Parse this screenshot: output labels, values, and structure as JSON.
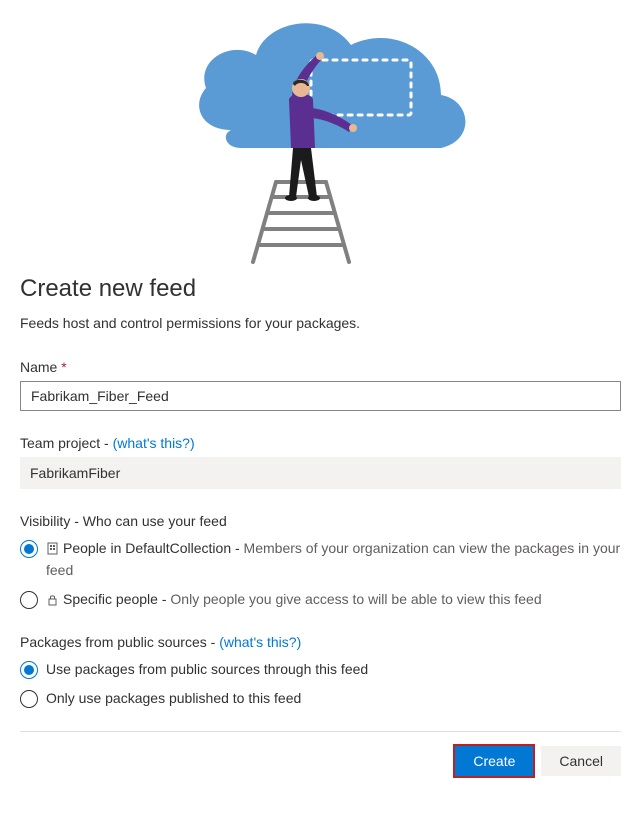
{
  "heading": "Create new feed",
  "subtitle": "Feeds host and control permissions for your packages.",
  "name": {
    "label": "Name",
    "required_mark": "*",
    "value": "Fabrikam_Fiber_Feed"
  },
  "team_project": {
    "label": "Team project - ",
    "help_link": "(what's this?)",
    "value": "FabrikamFiber"
  },
  "visibility": {
    "label": "Visibility - Who can use your feed",
    "options": [
      {
        "selected": true,
        "title_prefix": "People in DefaultCollection - ",
        "desc": "Members of your organization can view the packages in your feed"
      },
      {
        "selected": false,
        "title_prefix": "Specific people - ",
        "desc": "Only people you give access to will be able to view this feed"
      }
    ]
  },
  "packages": {
    "label": "Packages from public sources - ",
    "help_link": "(what's this?)",
    "options": [
      {
        "selected": true,
        "label": "Use packages from public sources through this feed"
      },
      {
        "selected": false,
        "label": "Only use packages published to this feed"
      }
    ]
  },
  "buttons": {
    "create": "Create",
    "cancel": "Cancel"
  }
}
